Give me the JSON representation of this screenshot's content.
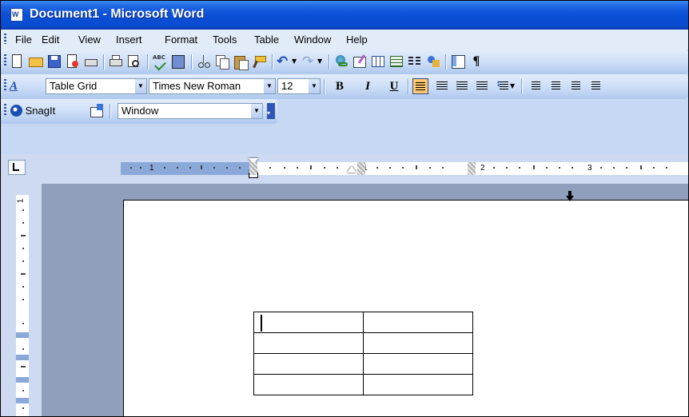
{
  "window": {
    "title": "Document1 - Microsoft Word",
    "app_icon_letter": "W"
  },
  "menu": [
    "File",
    "Edit",
    "View",
    "Insert",
    "Format",
    "Tools",
    "Table",
    "Window",
    "Help"
  ],
  "formatting": {
    "style_label": "Table Grid",
    "font_name": "Times New Roman",
    "font_size": "12",
    "bold": "B",
    "italic": "I",
    "underline": "U",
    "alignment": "align-left"
  },
  "snagit": {
    "label": "SnagIt",
    "capture_mode": "Window"
  },
  "ruler": {
    "numbers": [
      "1",
      "1",
      "2",
      "3"
    ],
    "vertical_number": "1"
  },
  "document": {
    "table": {
      "rows": 4,
      "columns": 2,
      "cells": [
        [
          "",
          ""
        ],
        [
          "",
          ""
        ],
        [
          "",
          ""
        ],
        [
          "",
          ""
        ]
      ]
    }
  },
  "colors": {
    "title_bar": "#0a4fd6",
    "toolbar": "#c6d8f4",
    "workspace": "#90a0bc",
    "highlight": "#ffc66c"
  },
  "icons": [
    "new-icon",
    "open-icon",
    "save-icon",
    "permission-icon",
    "print-icon",
    "print-preview-icon",
    "spelling-icon",
    "research-icon",
    "cut-icon",
    "copy-icon",
    "paste-icon",
    "format-painter-icon",
    "undo-icon",
    "redo-icon",
    "hyperlink-icon",
    "tables-borders-icon",
    "insert-table-icon",
    "insert-excel-icon",
    "columns-icon",
    "drawing-icon",
    "document-map-icon",
    "show-formatting-icon"
  ]
}
